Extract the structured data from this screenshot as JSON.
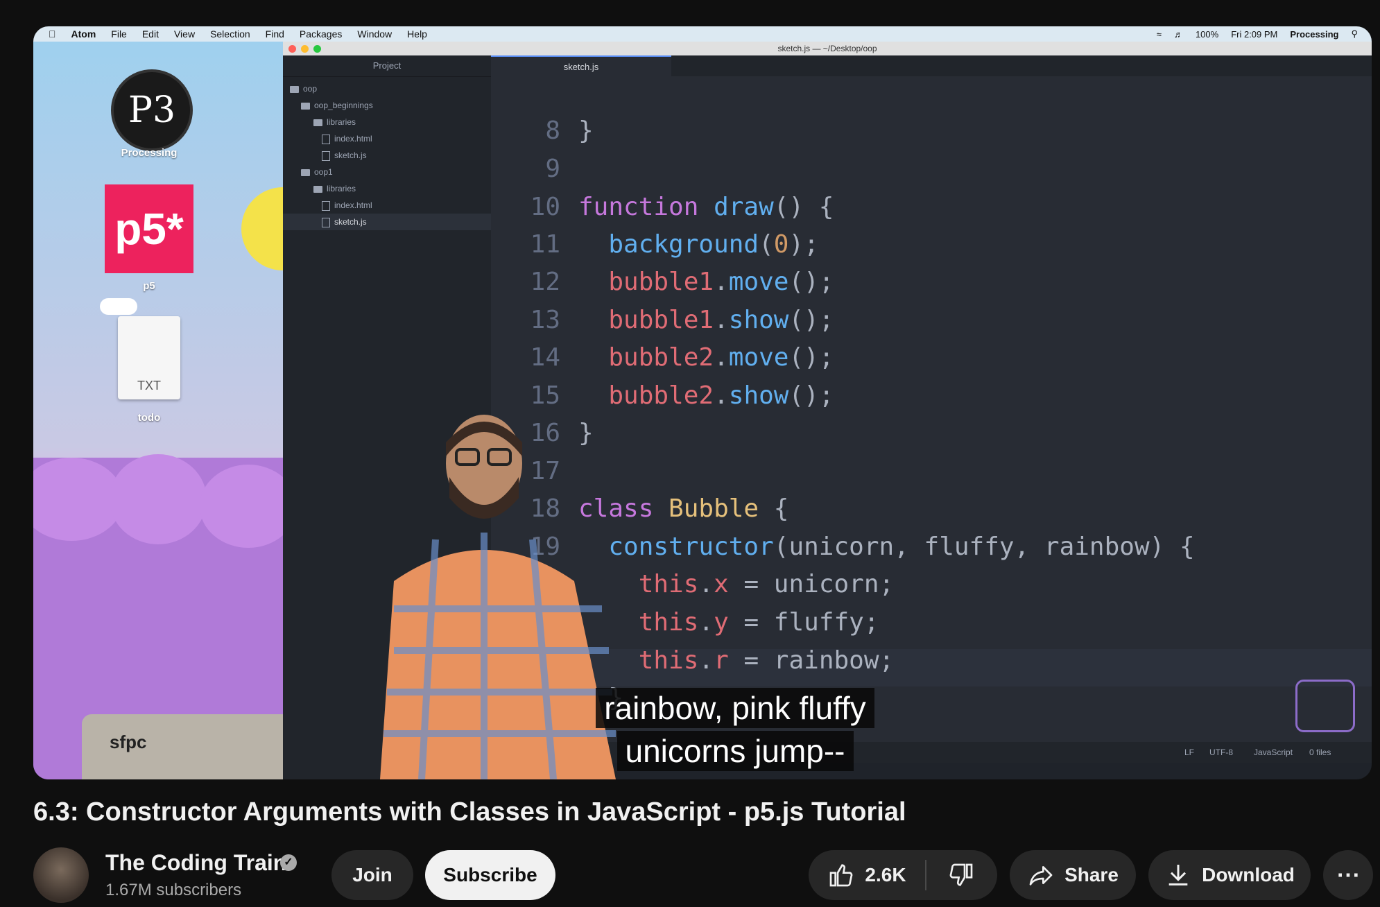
{
  "menubar": {
    "apple": "",
    "items": [
      "Atom",
      "File",
      "Edit",
      "View",
      "Selection",
      "Find",
      "Packages",
      "Window",
      "Help"
    ],
    "battery": "100%",
    "clock": "Fri 2:09 PM",
    "app": "Processing"
  },
  "desktop": {
    "icons": [
      {
        "label": "Processing",
        "glyph": "P3"
      },
      {
        "label": "p5",
        "glyph": "p5*"
      },
      {
        "label": "todo",
        "glyph": "TXT"
      }
    ],
    "laptop_sticker": "sfpc"
  },
  "atom": {
    "window_title": "sketch.js — ~/Desktop/oop",
    "tree_header": "Project",
    "tree": [
      {
        "name": "oop",
        "type": "folder",
        "depth": 0
      },
      {
        "name": "oop_beginnings",
        "type": "folder",
        "depth": 1
      },
      {
        "name": "libraries",
        "type": "folder",
        "depth": 2
      },
      {
        "name": "index.html",
        "type": "file",
        "depth": 2
      },
      {
        "name": "sketch.js",
        "type": "file",
        "depth": 2
      },
      {
        "name": "oop1",
        "type": "folder",
        "depth": 1
      },
      {
        "name": "libraries",
        "type": "folder",
        "depth": 2
      },
      {
        "name": "index.html",
        "type": "file",
        "depth": 2
      },
      {
        "name": "sketch.js",
        "type": "file",
        "depth": 2
      }
    ],
    "tab": "sketch.js",
    "line_numbers": [
      "8",
      "9",
      "10",
      "11",
      "12",
      "13",
      "14",
      "15",
      "16",
      "17",
      "18",
      "19",
      "",
      "",
      "",
      "",
      ""
    ],
    "status": {
      "lf": "LF",
      "encoding": "UTF-8",
      "grammar": "JavaScript",
      "files": "0 files"
    }
  },
  "caption": {
    "line1": "rainbow, pink fluffy",
    "line2": "unicorns jump--"
  },
  "video_title": "6.3: Constructor Arguments with Classes in JavaScript - p5.js Tutorial",
  "channel": {
    "name": "The Coding Train",
    "subscribers": "1.67M subscribers",
    "verified_icon": "check-circle"
  },
  "actions": {
    "join": "Join",
    "subscribe": "Subscribe",
    "likes": "2.6K",
    "share": "Share",
    "download": "Download"
  },
  "colors": {
    "background": "#0f0f0f",
    "pill": "#272727",
    "subscribe_bg": "#f1f1f1",
    "editor_bg": "#282c34"
  }
}
